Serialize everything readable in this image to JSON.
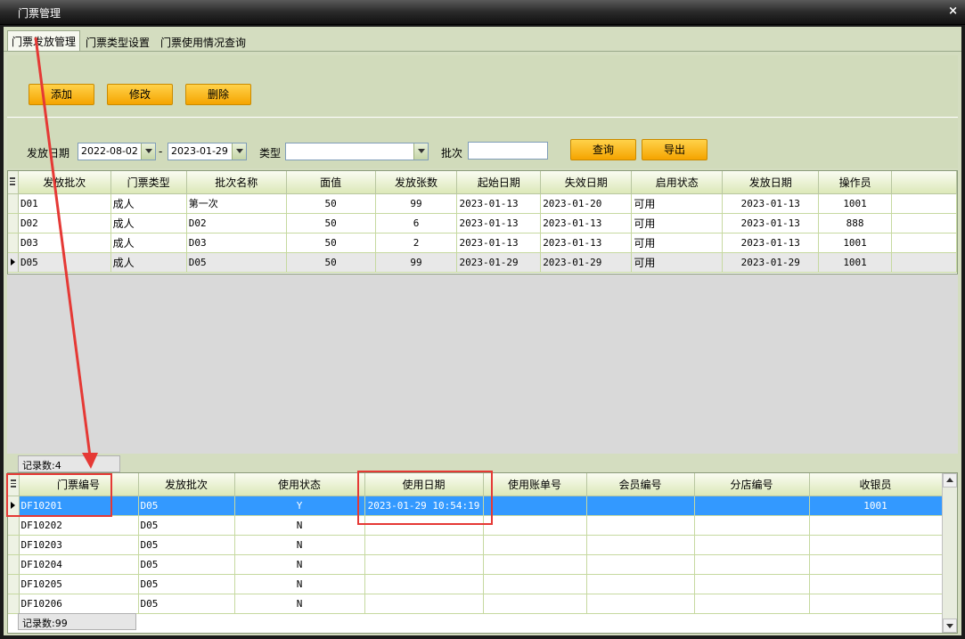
{
  "window": {
    "title": "门票管理",
    "close_glyph": "×"
  },
  "tabs": [
    {
      "label": "门票发放管理",
      "active": true
    },
    {
      "label": "门票类型设置",
      "active": false
    },
    {
      "label": "门票使用情况查询",
      "active": false
    }
  ],
  "toolbar": {
    "add_label": "添加",
    "edit_label": "修改",
    "delete_label": "删除"
  },
  "search": {
    "date_label": "发放日期",
    "date_from": "2022-08-02",
    "date_sep": "-",
    "date_to": "2023-01-29",
    "type_label": "类型",
    "type_value": "",
    "batch_label": "批次",
    "batch_value": "",
    "query_label": "查询",
    "export_label": "导出"
  },
  "batch_grid": {
    "columns": [
      "发放批次",
      "门票类型",
      "批次名称",
      "面值",
      "发放张数",
      "起始日期",
      "失效日期",
      "启用状态",
      "发放日期",
      "操作员"
    ],
    "rows": [
      [
        "D01",
        "成人",
        "第一次",
        "50",
        "99",
        "2023-01-13",
        "2023-01-20",
        "可用",
        "2023-01-13",
        "1001"
      ],
      [
        "D02",
        "成人",
        "D02",
        "50",
        "6",
        "2023-01-13",
        "2023-01-13",
        "可用",
        "2023-01-13",
        "888"
      ],
      [
        "D03",
        "成人",
        "D03",
        "50",
        "2",
        "2023-01-13",
        "2023-01-13",
        "可用",
        "2023-01-13",
        "1001"
      ],
      [
        "D05",
        "成人",
        "D05",
        "50",
        "99",
        "2023-01-29",
        "2023-01-29",
        "可用",
        "2023-01-29",
        "1001"
      ]
    ],
    "record_count": "记录数:4"
  },
  "ticket_grid": {
    "columns": [
      "门票编号",
      "发放批次",
      "使用状态",
      "使用日期",
      "使用账单号",
      "会员编号",
      "分店编号",
      "收银员"
    ],
    "rows": [
      [
        "DF10201",
        "D05",
        "Y",
        "2023-01-29 10:54:19",
        "",
        "",
        "",
        "1001"
      ],
      [
        "DF10202",
        "D05",
        "N",
        "",
        "",
        "",
        "",
        ""
      ],
      [
        "DF10203",
        "D05",
        "N",
        "",
        "",
        "",
        "",
        ""
      ],
      [
        "DF10204",
        "D05",
        "N",
        "",
        "",
        "",
        "",
        ""
      ],
      [
        "DF10205",
        "D05",
        "N",
        "",
        "",
        "",
        "",
        ""
      ],
      [
        "DF10206",
        "D05",
        "N",
        "",
        "",
        "",
        "",
        ""
      ]
    ],
    "record_count": "记录数:99"
  },
  "colors": {
    "accent_button": "#f5a400",
    "selection": "#3399ff",
    "annotation": "#e53935",
    "panel": "#d1dbbb"
  }
}
